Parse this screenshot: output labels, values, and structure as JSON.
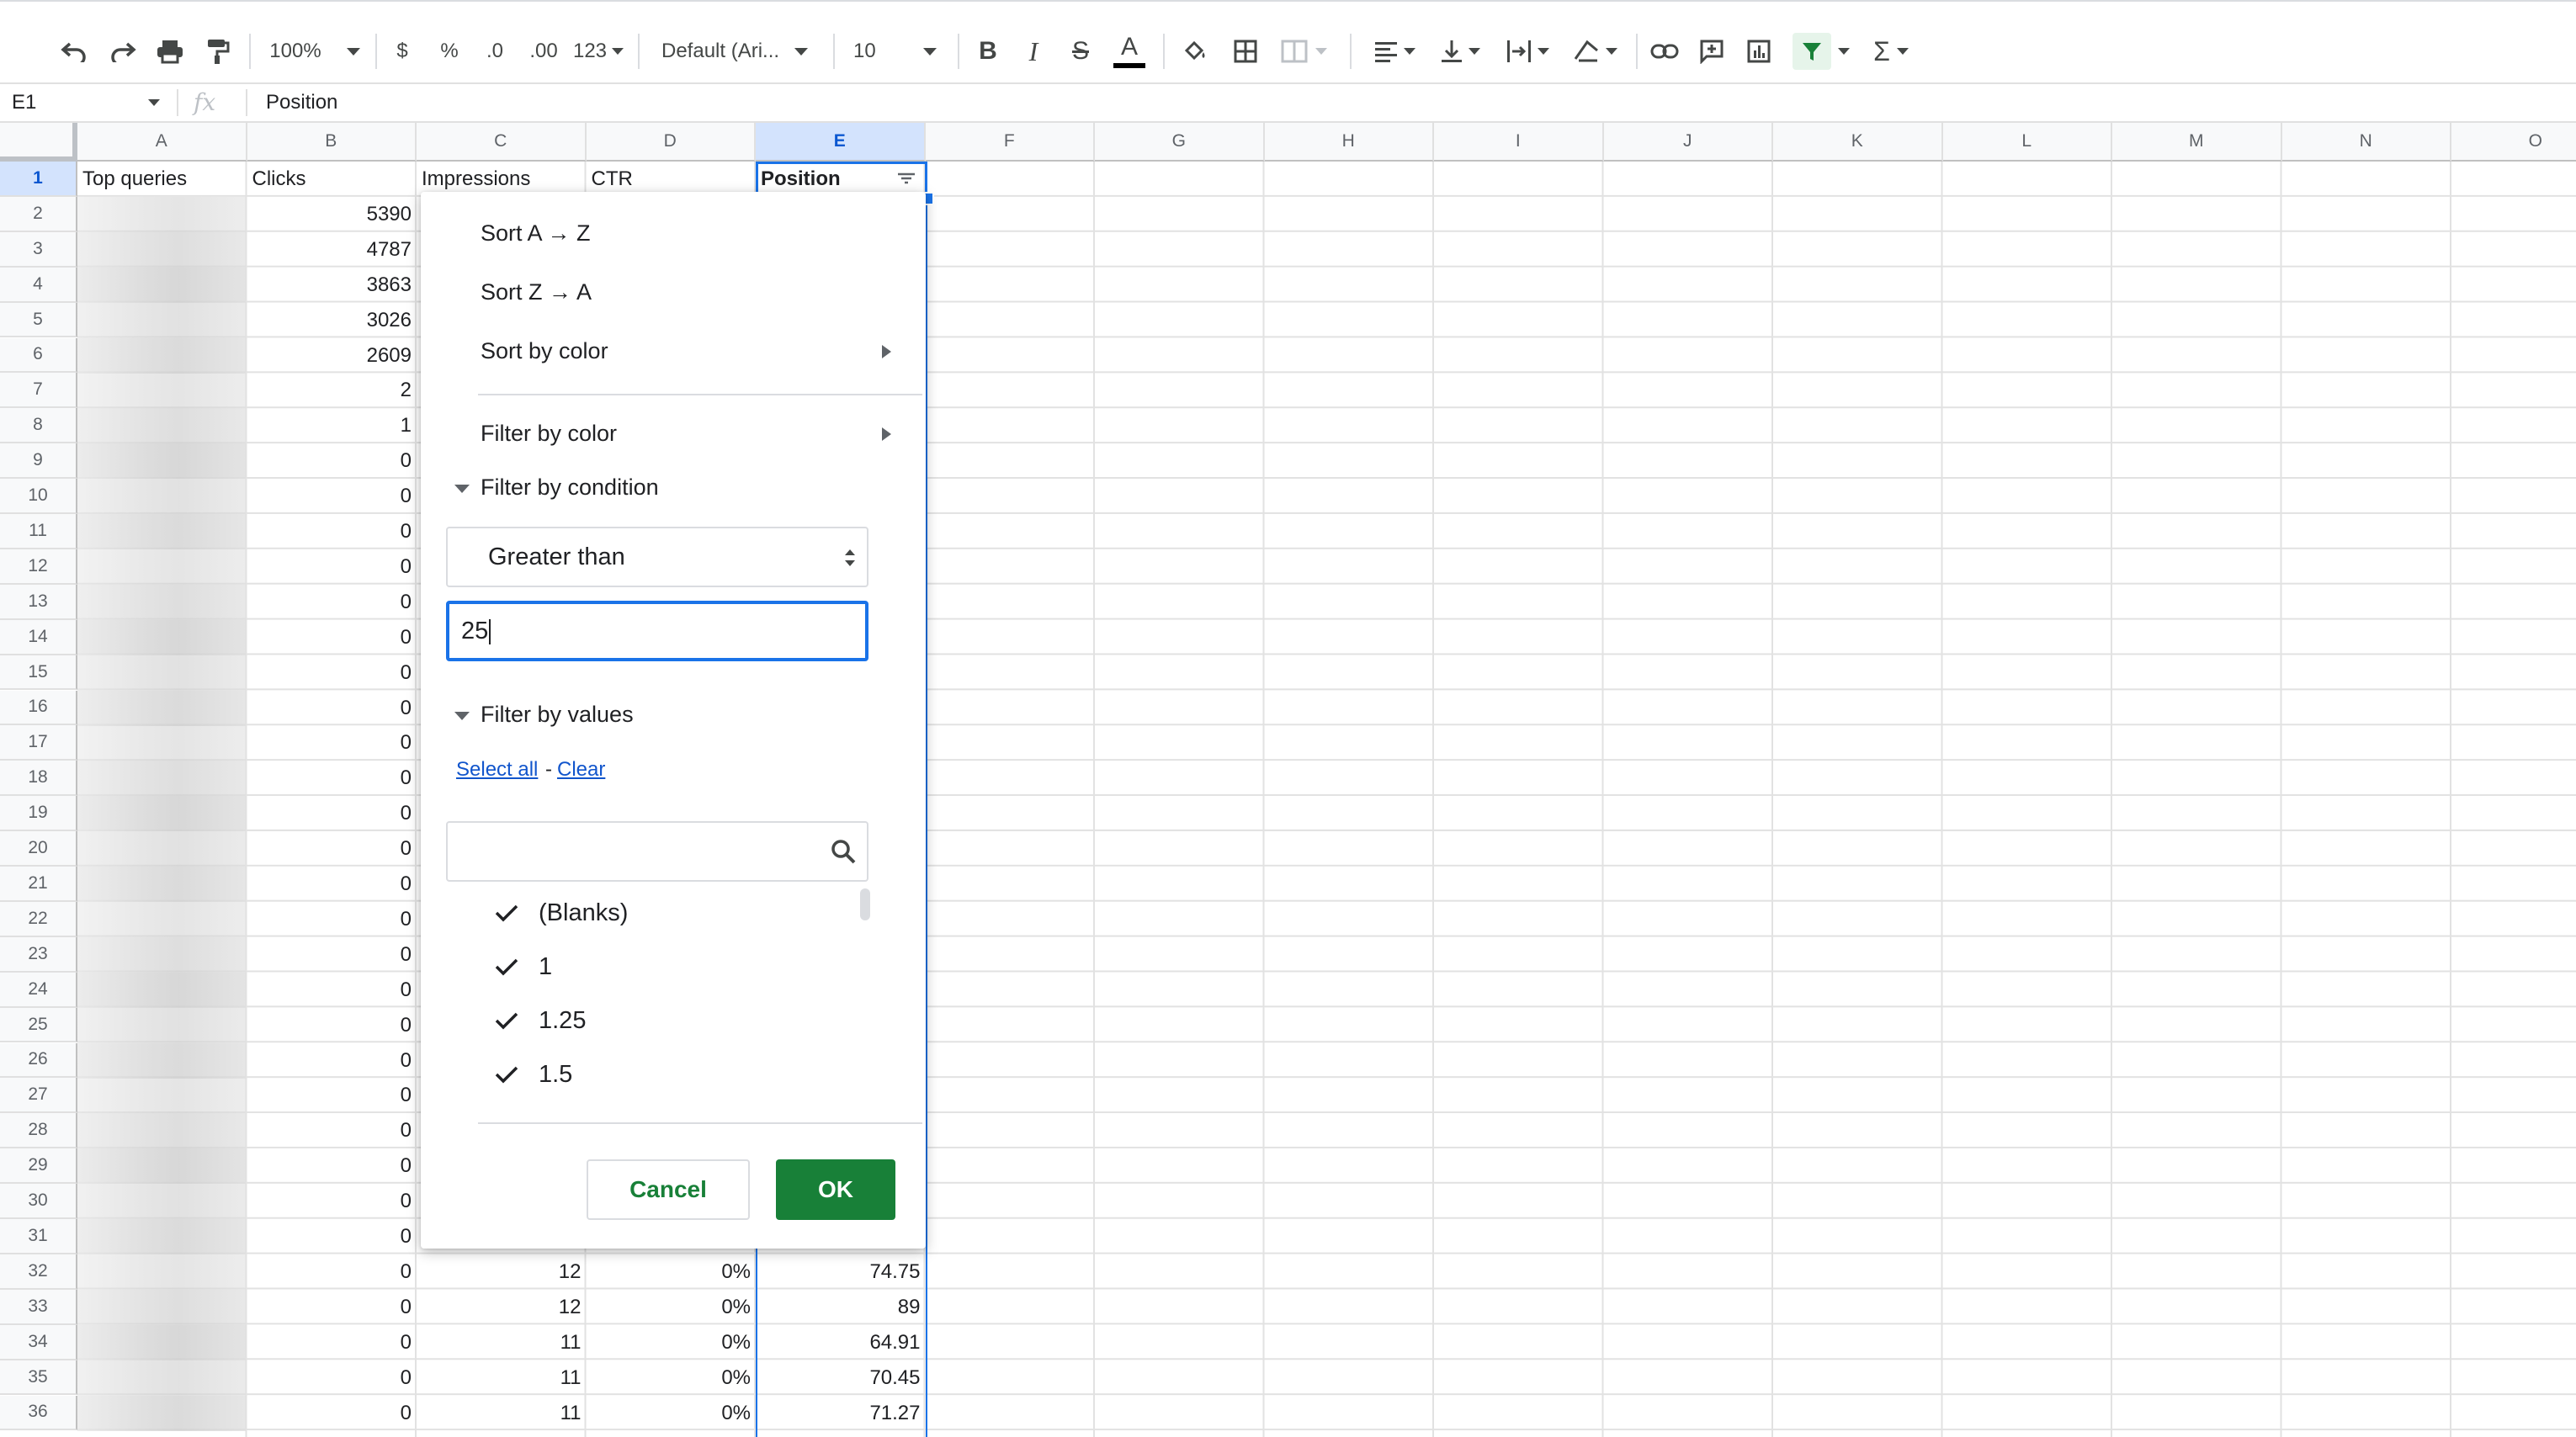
{
  "toolbar": {
    "zoom": "100%",
    "currency": "$",
    "percent": "%",
    "decrease_decimal": ".0",
    "increase_decimal": ".00",
    "more_formats": "123",
    "font_family": "Default (Ari...",
    "font_size": "10",
    "bold": "B",
    "italic": "I",
    "strikethrough": "S",
    "text_color": "A",
    "functions": "Σ",
    "filter_active_color": "#188038"
  },
  "formula_bar": {
    "cell_ref": "E1",
    "fx": "fx",
    "content": "Position"
  },
  "grid": {
    "columns": [
      "A",
      "B",
      "C",
      "D",
      "E",
      "F",
      "G",
      "H",
      "I",
      "J",
      "K",
      "L",
      "M",
      "N",
      "O"
    ],
    "selected_column": "E",
    "rows": [
      "1",
      "2",
      "3",
      "4",
      "5",
      "6",
      "7",
      "8",
      "9",
      "10",
      "11",
      "12",
      "13",
      "14",
      "15",
      "16",
      "17",
      "18",
      "19",
      "20",
      "21",
      "22",
      "23",
      "24",
      "25",
      "26",
      "27",
      "28",
      "29",
      "30",
      "31",
      "32",
      "33",
      "34",
      "35",
      "36"
    ],
    "header_row": [
      "Top queries",
      "Clicks",
      "Impressions",
      "CTR",
      "Position"
    ],
    "clicks": [
      "5390",
      "4787",
      "3863",
      "3026",
      "2609",
      "2",
      "1",
      "0",
      "0",
      "0",
      "0",
      "0",
      "0",
      "0",
      "0",
      "0",
      "0",
      "0",
      "0",
      "0",
      "0",
      "0",
      "0",
      "0",
      "0",
      "0",
      "0",
      "0",
      "0",
      "0",
      "0",
      "0",
      "0",
      "0",
      "0"
    ],
    "visible_rows": [
      {
        "impressions": "12",
        "ctr": "0%",
        "position": "74.75"
      },
      {
        "impressions": "12",
        "ctr": "0%",
        "position": "89"
      },
      {
        "impressions": "11",
        "ctr": "0%",
        "position": "64.91"
      },
      {
        "impressions": "11",
        "ctr": "0%",
        "position": "70.45"
      },
      {
        "impressions": "11",
        "ctr": "0%",
        "position": "71.27"
      }
    ]
  },
  "filter_menu": {
    "sort_az": "Sort A → Z",
    "sort_za": "Sort Z → A",
    "sort_by_color": "Sort by color",
    "filter_by_color": "Filter by color",
    "filter_by_condition": "Filter by condition",
    "condition": "Greater than",
    "condition_value": "25",
    "filter_by_values": "Filter by values",
    "select_all": "Select all",
    "link_separator": "-",
    "clear": "Clear",
    "values_search_placeholder": "",
    "values": [
      "(Blanks)",
      "1",
      "1.25",
      "1.5"
    ],
    "cancel_label": "Cancel",
    "ok_label": "OK"
  }
}
